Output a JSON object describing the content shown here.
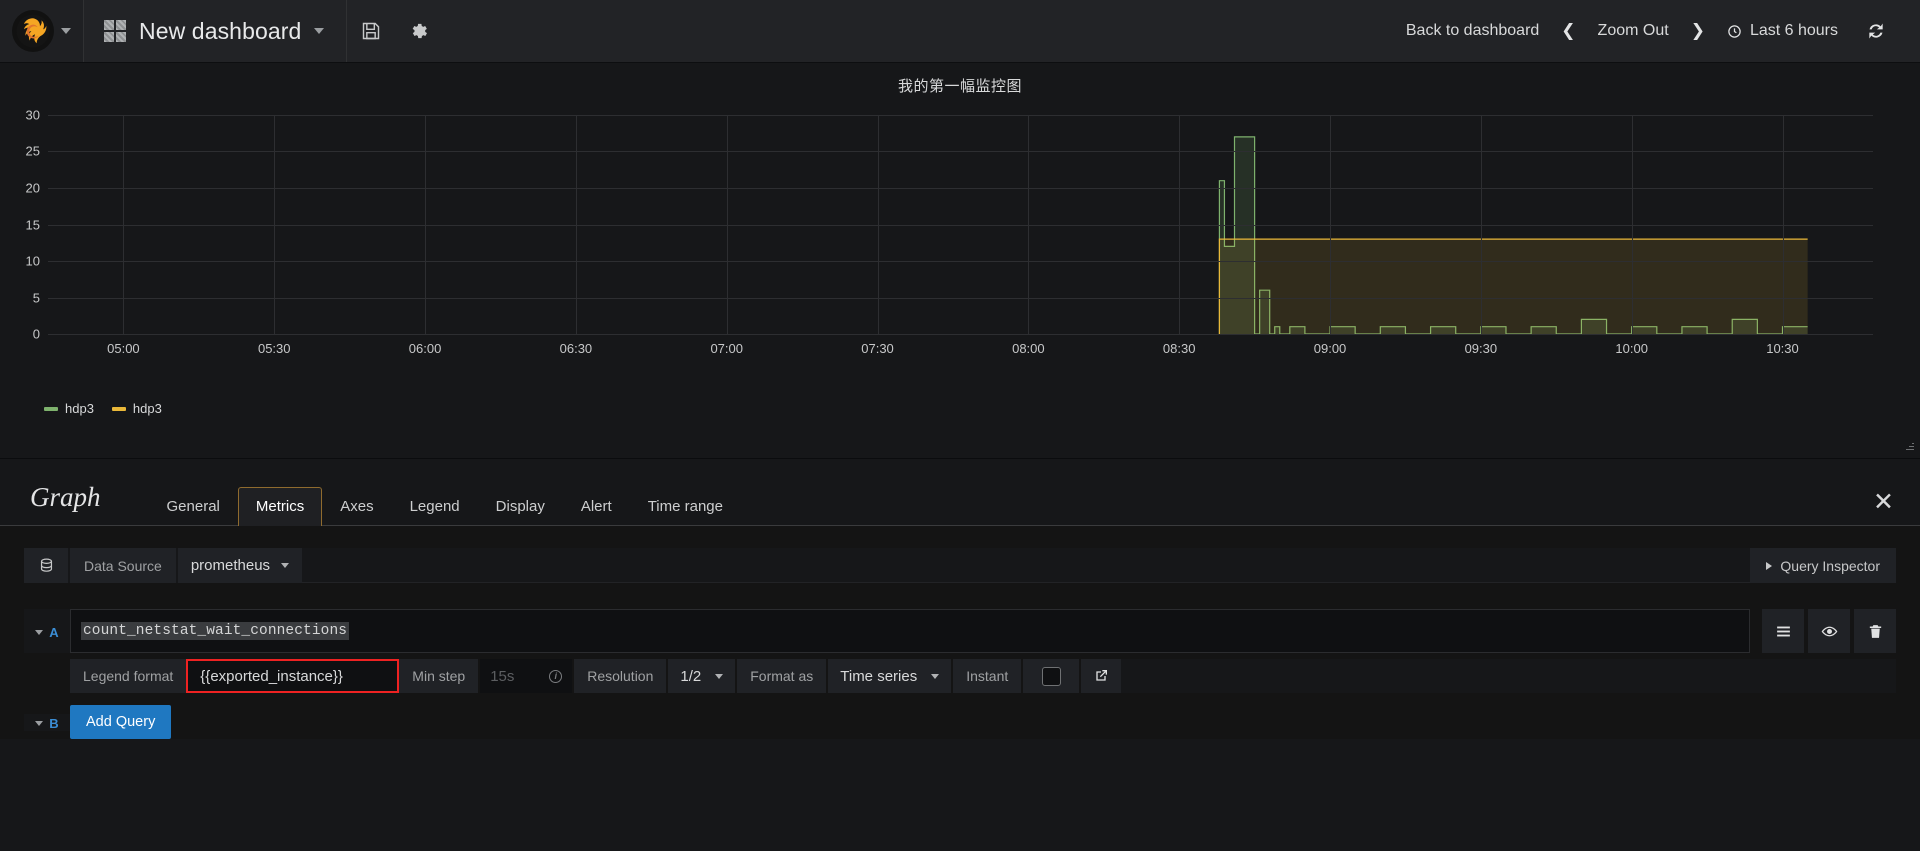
{
  "navbar": {
    "logo_icon": "grafana-logo-icon",
    "logo_caret_icon": "chevron-down-icon",
    "dashboard_icon": "dashboard-grid-icon",
    "dashboard_title": "New dashboard",
    "dashboard_caret_icon": "chevron-down-icon",
    "save_icon": "save-floppy-icon",
    "settings_icon": "gear-icon",
    "back_to_dashboard": "Back to dashboard",
    "zoom_prev_icon": "chevron-left-icon",
    "zoom_out": "Zoom Out",
    "zoom_next_icon": "chevron-right-icon",
    "time_clock_icon": "clock-icon",
    "time_range": "Last 6 hours",
    "refresh_icon": "refresh-icon"
  },
  "panel": {
    "title": "我的第一幅监控图",
    "resize_grip_icon": "resize-grip-icon"
  },
  "chart_data": {
    "type": "line",
    "title": "我的第一幅监控图",
    "xlabel": "",
    "ylabel": "",
    "ylim": [
      0,
      30
    ],
    "yticks": [
      0,
      5,
      10,
      15,
      20,
      25,
      30
    ],
    "xticks": [
      "05:00",
      "05:30",
      "06:00",
      "06:30",
      "07:00",
      "07:30",
      "08:00",
      "08:30",
      "09:00",
      "09:30",
      "10:00",
      "10:30"
    ],
    "grid": true,
    "legend_position": "bottom-left",
    "legend": [
      "hdp3",
      "hdp3"
    ],
    "colors": {
      "series_green": "#7EB26D",
      "series_yellow": "#EAB839"
    },
    "series": [
      {
        "name": "hdp3",
        "color": "#7EB26D",
        "fill": true,
        "x": [
          "08:38",
          "08:39",
          "08:40",
          "08:41",
          "08:42",
          "08:43",
          "08:44",
          "08:45",
          "08:46",
          "08:47",
          "08:48",
          "08:49",
          "08:50",
          "08:52",
          "08:55",
          "09:00",
          "09:05",
          "09:10",
          "09:15",
          "09:20",
          "09:25",
          "09:30",
          "09:35",
          "09:40",
          "09:45",
          "09:50",
          "09:55",
          "10:00",
          "10:05",
          "10:10",
          "10:15",
          "10:20",
          "10:25",
          "10:30",
          "10:35"
        ],
        "values": [
          0,
          21,
          12,
          12,
          27,
          27,
          27,
          27,
          0,
          6,
          6,
          0,
          1,
          0,
          1,
          0,
          1,
          0,
          1,
          0,
          1,
          0,
          1,
          0,
          1,
          0,
          2,
          0,
          1,
          0,
          1,
          0,
          2,
          0,
          1
        ]
      },
      {
        "name": "hdp3",
        "color": "#EAB839",
        "fill": true,
        "x": [
          "08:38",
          "08:40",
          "09:00",
          "09:30",
          "10:00",
          "10:30",
          "10:35"
        ],
        "values": [
          0,
          13,
          13,
          13,
          13,
          13,
          13
        ]
      }
    ]
  },
  "editor": {
    "heading": "Graph",
    "tabs": [
      {
        "label": "General",
        "active": false
      },
      {
        "label": "Metrics",
        "active": true
      },
      {
        "label": "Axes",
        "active": false
      },
      {
        "label": "Legend",
        "active": false
      },
      {
        "label": "Display",
        "active": false
      },
      {
        "label": "Alert",
        "active": false
      },
      {
        "label": "Time range",
        "active": false
      }
    ],
    "close_icon": "close-icon",
    "datasource": {
      "db_icon": "database-icon",
      "label": "Data Source",
      "value": "prometheus",
      "caret_icon": "chevron-down-icon"
    },
    "query_inspector": {
      "label": "Query Inspector",
      "caret_icon": "triangle-right-icon"
    },
    "queries": [
      {
        "letter": "A",
        "collapse_icon": "chevron-down-icon",
        "expression": "count_netstat_wait_connections",
        "actions": [
          {
            "icon": "list-lines-icon"
          },
          {
            "icon": "eye-icon"
          },
          {
            "icon": "trash-icon"
          }
        ],
        "options": {
          "legend_format_label": "Legend format",
          "legend_format_value": "{{exported_instance}}",
          "min_step_label": "Min step",
          "min_step_placeholder": "15s",
          "min_step_info_icon": "info-icon",
          "resolution_label": "Resolution",
          "resolution_value": "1/2",
          "resolution_caret_icon": "chevron-down-icon",
          "format_as_label": "Format as",
          "format_as_value": "Time series",
          "format_as_caret_icon": "chevron-down-icon",
          "instant_label": "Instant",
          "instant_checked": false,
          "external_link_icon": "external-link-icon"
        }
      }
    ],
    "add_query": {
      "letter": "B",
      "collapse_icon": "chevron-down-icon",
      "label": "Add Query"
    }
  }
}
